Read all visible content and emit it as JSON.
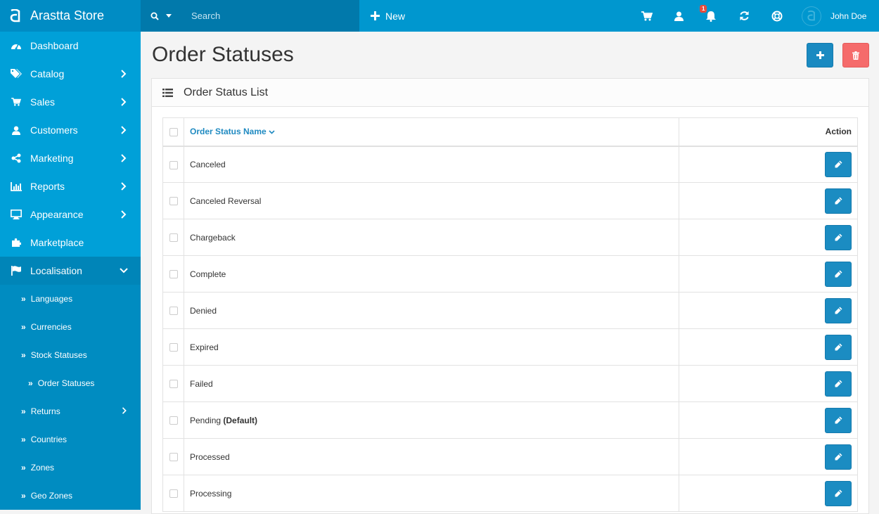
{
  "app": {
    "brand": "Arastta Store"
  },
  "topbar": {
    "search_placeholder": "Search",
    "new_label": "New",
    "notification_count": "1",
    "user_name": "John Doe"
  },
  "sidebar": {
    "items": [
      {
        "label": "Dashboard",
        "icon": "dashboard-icon",
        "has_children": false
      },
      {
        "label": "Catalog",
        "icon": "tags-icon",
        "has_children": true
      },
      {
        "label": "Sales",
        "icon": "cart-icon",
        "has_children": true
      },
      {
        "label": "Customers",
        "icon": "user-icon",
        "has_children": true
      },
      {
        "label": "Marketing",
        "icon": "share-icon",
        "has_children": true
      },
      {
        "label": "Reports",
        "icon": "bar-chart-icon",
        "has_children": true
      },
      {
        "label": "Appearance",
        "icon": "desktop-icon",
        "has_children": true
      },
      {
        "label": "Marketplace",
        "icon": "puzzle-icon",
        "has_children": false
      },
      {
        "label": "Localisation",
        "icon": "flag-icon",
        "has_children": true,
        "expanded": true
      }
    ],
    "localisation_sub": [
      {
        "label": "Languages"
      },
      {
        "label": "Currencies"
      },
      {
        "label": "Stock Statuses"
      },
      {
        "label": "Order Statuses",
        "current": true
      },
      {
        "label": "Returns",
        "has_children": true
      },
      {
        "label": "Countries"
      },
      {
        "label": "Zones"
      },
      {
        "label": "Geo Zones"
      }
    ]
  },
  "page": {
    "title": "Order Statuses",
    "add_button": "add-icon",
    "delete_button": "trash-icon"
  },
  "panel": {
    "title": "Order Status List",
    "columns": {
      "name": "Order Status Name",
      "action": "Action"
    },
    "rows": [
      {
        "name": "Canceled",
        "suffix": ""
      },
      {
        "name": "Canceled Reversal",
        "suffix": ""
      },
      {
        "name": "Chargeback",
        "suffix": ""
      },
      {
        "name": "Complete",
        "suffix": ""
      },
      {
        "name": "Denied",
        "suffix": ""
      },
      {
        "name": "Expired",
        "suffix": ""
      },
      {
        "name": "Failed",
        "suffix": ""
      },
      {
        "name": "Pending",
        "suffix": "(Default)"
      },
      {
        "name": "Processed",
        "suffix": ""
      },
      {
        "name": "Processing",
        "suffix": ""
      }
    ]
  },
  "colors": {
    "topbar": "#0097cf",
    "sidebar": "#00a0d8",
    "primary_button": "#1b8cc2",
    "danger_button": "#f56b6b"
  }
}
